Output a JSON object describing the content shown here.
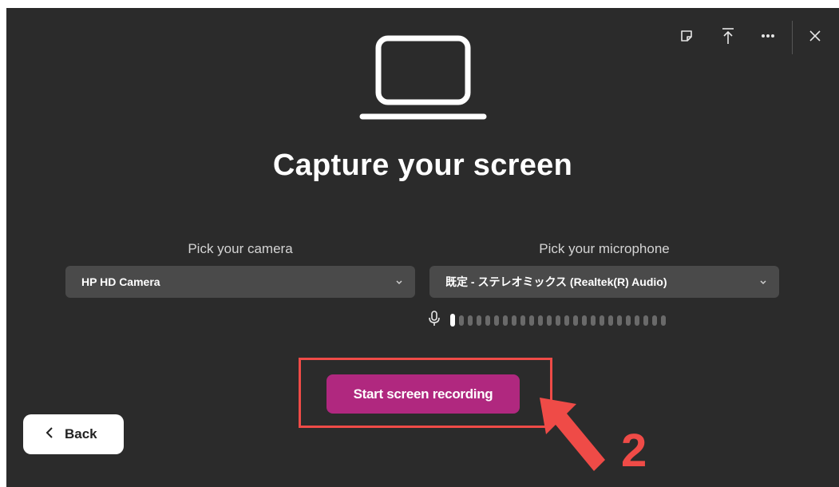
{
  "window": {
    "heading": "Capture your screen"
  },
  "toolbar": {
    "icons": [
      "sticky-note-icon",
      "upload-icon",
      "more-icon",
      "close-icon"
    ]
  },
  "camera": {
    "label": "Pick your camera",
    "selected": "HP HD Camera"
  },
  "microphone": {
    "label": "Pick your microphone",
    "selected": "既定 - ステレオミックス (Realtek(R) Audio)",
    "level_bars_total": 25,
    "level_bars_active": 1
  },
  "actions": {
    "start_label": "Start screen recording",
    "back_label": "Back"
  },
  "annotation": {
    "number": "2",
    "color": "#ef4b47"
  },
  "colors": {
    "background": "#2b2b2b",
    "accent": "#b0287f",
    "dropdown": "#4a4a4a"
  }
}
